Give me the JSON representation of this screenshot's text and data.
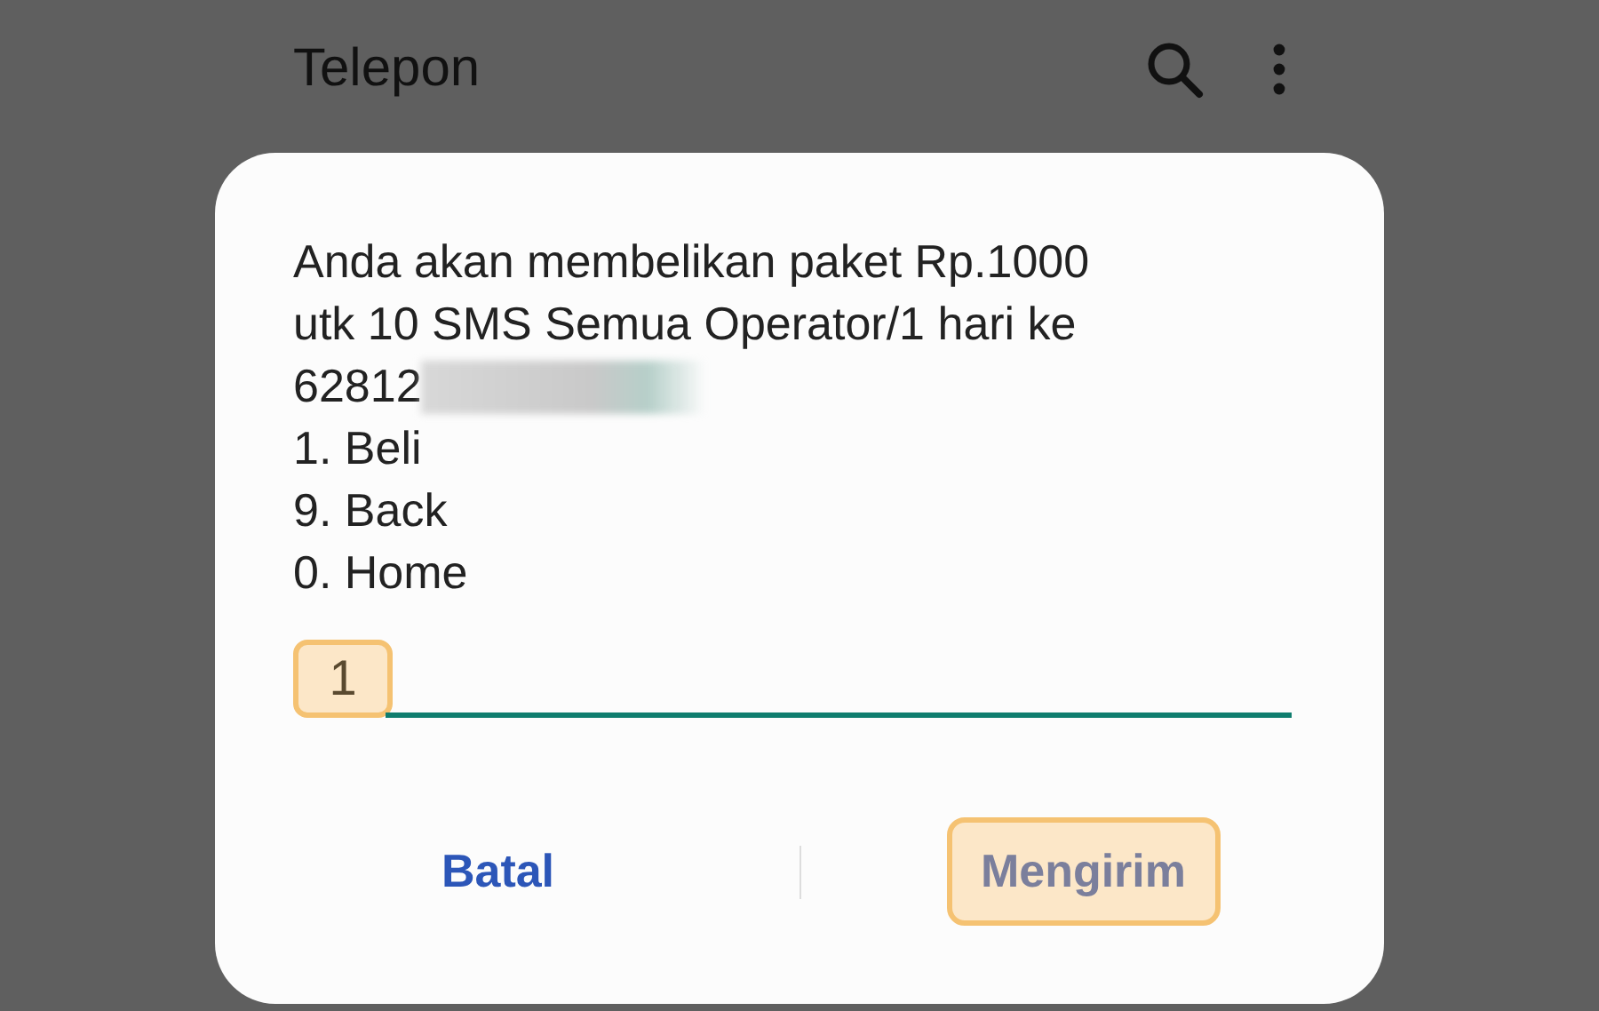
{
  "app_bar": {
    "title": "Telepon"
  },
  "dialog": {
    "message_lines": [
      {
        "text": "Anda akan membelikan paket Rp.1000",
        "redacted": false
      },
      {
        "text": "utk 10 SMS Semua Operator/1 hari ke",
        "redacted": false
      },
      {
        "text": "62812",
        "redacted": true
      },
      {
        "text": "1. Beli",
        "redacted": false
      },
      {
        "text": "9. Back",
        "redacted": false
      },
      {
        "text": "0. Home",
        "redacted": false
      }
    ],
    "input": {
      "value": "1",
      "highlighted": true
    },
    "buttons": [
      {
        "label": "Batal",
        "kind": "cancel",
        "highlighted": false
      },
      {
        "label": "Mengirim",
        "kind": "send",
        "highlighted": true
      }
    ]
  }
}
